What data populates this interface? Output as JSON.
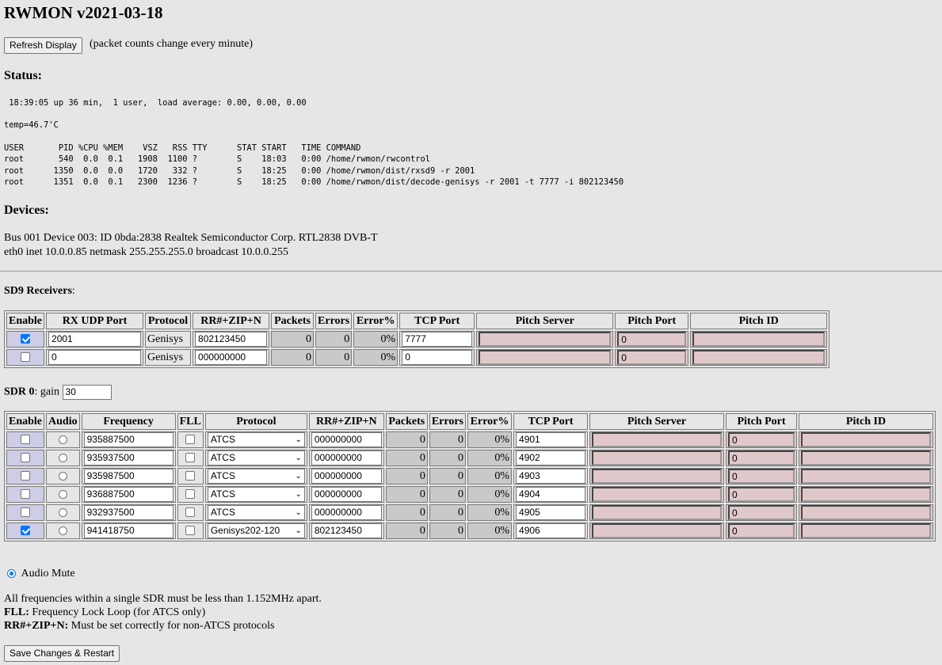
{
  "app_title": "RWMON v2021-03-18",
  "refresh_button": "Refresh Display",
  "refresh_note": "(packet counts change every minute)",
  "status": {
    "heading": "Status:",
    "uptime": " 18:39:05 up 36 min,  1 user,  load average: 0.00, 0.00, 0.00",
    "temp": "temp=46.7'C",
    "ps": "USER       PID %CPU %MEM    VSZ   RSS TTY      STAT START   TIME COMMAND\nroot       540  0.0  0.1   1908  1100 ?        S    18:03   0:00 /home/rwmon/rwcontrol\nroot      1350  0.0  0.0   1720   332 ?        S    18:25   0:00 /home/rwmon/dist/rxsd9 -r 2001\nroot      1351  0.0  0.1   2300  1236 ?        S    18:25   0:00 /home/rwmon/dist/decode-genisys -r 2001 -t 7777 -i 802123450"
  },
  "devices": {
    "heading": "Devices:",
    "usb": "Bus 001 Device 003: ID 0bda:2838 Realtek Semiconductor Corp. RTL2838 DVB-T",
    "eth": "eth0 inet 10.0.0.85 netmask 255.255.255.0 broadcast 10.0.0.255"
  },
  "sd9": {
    "heading": "SD9 Receivers",
    "heading_suffix": ":",
    "columns": [
      "Enable",
      "RX UDP Port",
      "Protocol",
      "RR#+ZIP+N",
      "Packets",
      "Errors",
      "Error%",
      "TCP Port",
      "Pitch Server",
      "Pitch Port",
      "Pitch ID"
    ],
    "rows": [
      {
        "enabled": true,
        "rx_udp_port": "2001",
        "protocol": "Genisys",
        "rr_zip_n": "802123450",
        "packets": "0",
        "errors": "0",
        "error_pct": "0%",
        "tcp_port": "7777",
        "pitch_server": "",
        "pitch_port": "0",
        "pitch_id": ""
      },
      {
        "enabled": false,
        "rx_udp_port": "0",
        "protocol": "Genisys",
        "rr_zip_n": "000000000",
        "packets": "0",
        "errors": "0",
        "error_pct": "0%",
        "tcp_port": "0",
        "pitch_server": "",
        "pitch_port": "0",
        "pitch_id": ""
      }
    ]
  },
  "sdr": {
    "label": "SDR 0",
    "gain_label": ": gain",
    "gain": "30",
    "columns": [
      "Enable",
      "Audio",
      "Frequency",
      "FLL",
      "Protocol",
      "RR#+ZIP+N",
      "Packets",
      "Errors",
      "Error%",
      "TCP Port",
      "Pitch Server",
      "Pitch Port",
      "Pitch ID"
    ],
    "rows": [
      {
        "enabled": false,
        "audio": false,
        "frequency": "935887500",
        "fll": false,
        "protocol": "ATCS",
        "rr_zip_n": "000000000",
        "packets": "0",
        "errors": "0",
        "error_pct": "0%",
        "tcp_port": "4901",
        "pitch_server": "",
        "pitch_port": "0",
        "pitch_id": ""
      },
      {
        "enabled": false,
        "audio": false,
        "frequency": "935937500",
        "fll": false,
        "protocol": "ATCS",
        "rr_zip_n": "000000000",
        "packets": "0",
        "errors": "0",
        "error_pct": "0%",
        "tcp_port": "4902",
        "pitch_server": "",
        "pitch_port": "0",
        "pitch_id": ""
      },
      {
        "enabled": false,
        "audio": false,
        "frequency": "935987500",
        "fll": false,
        "protocol": "ATCS",
        "rr_zip_n": "000000000",
        "packets": "0",
        "errors": "0",
        "error_pct": "0%",
        "tcp_port": "4903",
        "pitch_server": "",
        "pitch_port": "0",
        "pitch_id": ""
      },
      {
        "enabled": false,
        "audio": false,
        "frequency": "936887500",
        "fll": false,
        "protocol": "ATCS",
        "rr_zip_n": "000000000",
        "packets": "0",
        "errors": "0",
        "error_pct": "0%",
        "tcp_port": "4904",
        "pitch_server": "",
        "pitch_port": "0",
        "pitch_id": ""
      },
      {
        "enabled": false,
        "audio": false,
        "frequency": "932937500",
        "fll": false,
        "protocol": "ATCS",
        "rr_zip_n": "000000000",
        "packets": "0",
        "errors": "0",
        "error_pct": "0%",
        "tcp_port": "4905",
        "pitch_server": "",
        "pitch_port": "0",
        "pitch_id": ""
      },
      {
        "enabled": true,
        "audio": false,
        "frequency": "941418750",
        "fll": false,
        "protocol": "Genisys202-120",
        "rr_zip_n": "802123450",
        "packets": "0",
        "errors": "0",
        "error_pct": "0%",
        "tcp_port": "4906",
        "pitch_server": "",
        "pitch_port": "0",
        "pitch_id": ""
      }
    ]
  },
  "audio_mute": {
    "label": "Audio Mute",
    "selected": true
  },
  "notes": {
    "freq": "All frequencies within a single SDR must be less than 1.152MHz apart.",
    "fll_bold": "FLL:",
    "fll_text": " Frequency Lock Loop (for ATCS only)",
    "rr_bold": "RR#+ZIP+N:",
    "rr_text": " Must be set correctly for non-ATCS protocols"
  },
  "save_button": "Save Changes & Restart",
  "colors": {
    "background": "#e6e6e6",
    "pitch_cell": "#e0c8ca",
    "enable_cell": "#cdcde6",
    "count_cell": "#c9c9c9",
    "check_accent": "#0075ff"
  }
}
